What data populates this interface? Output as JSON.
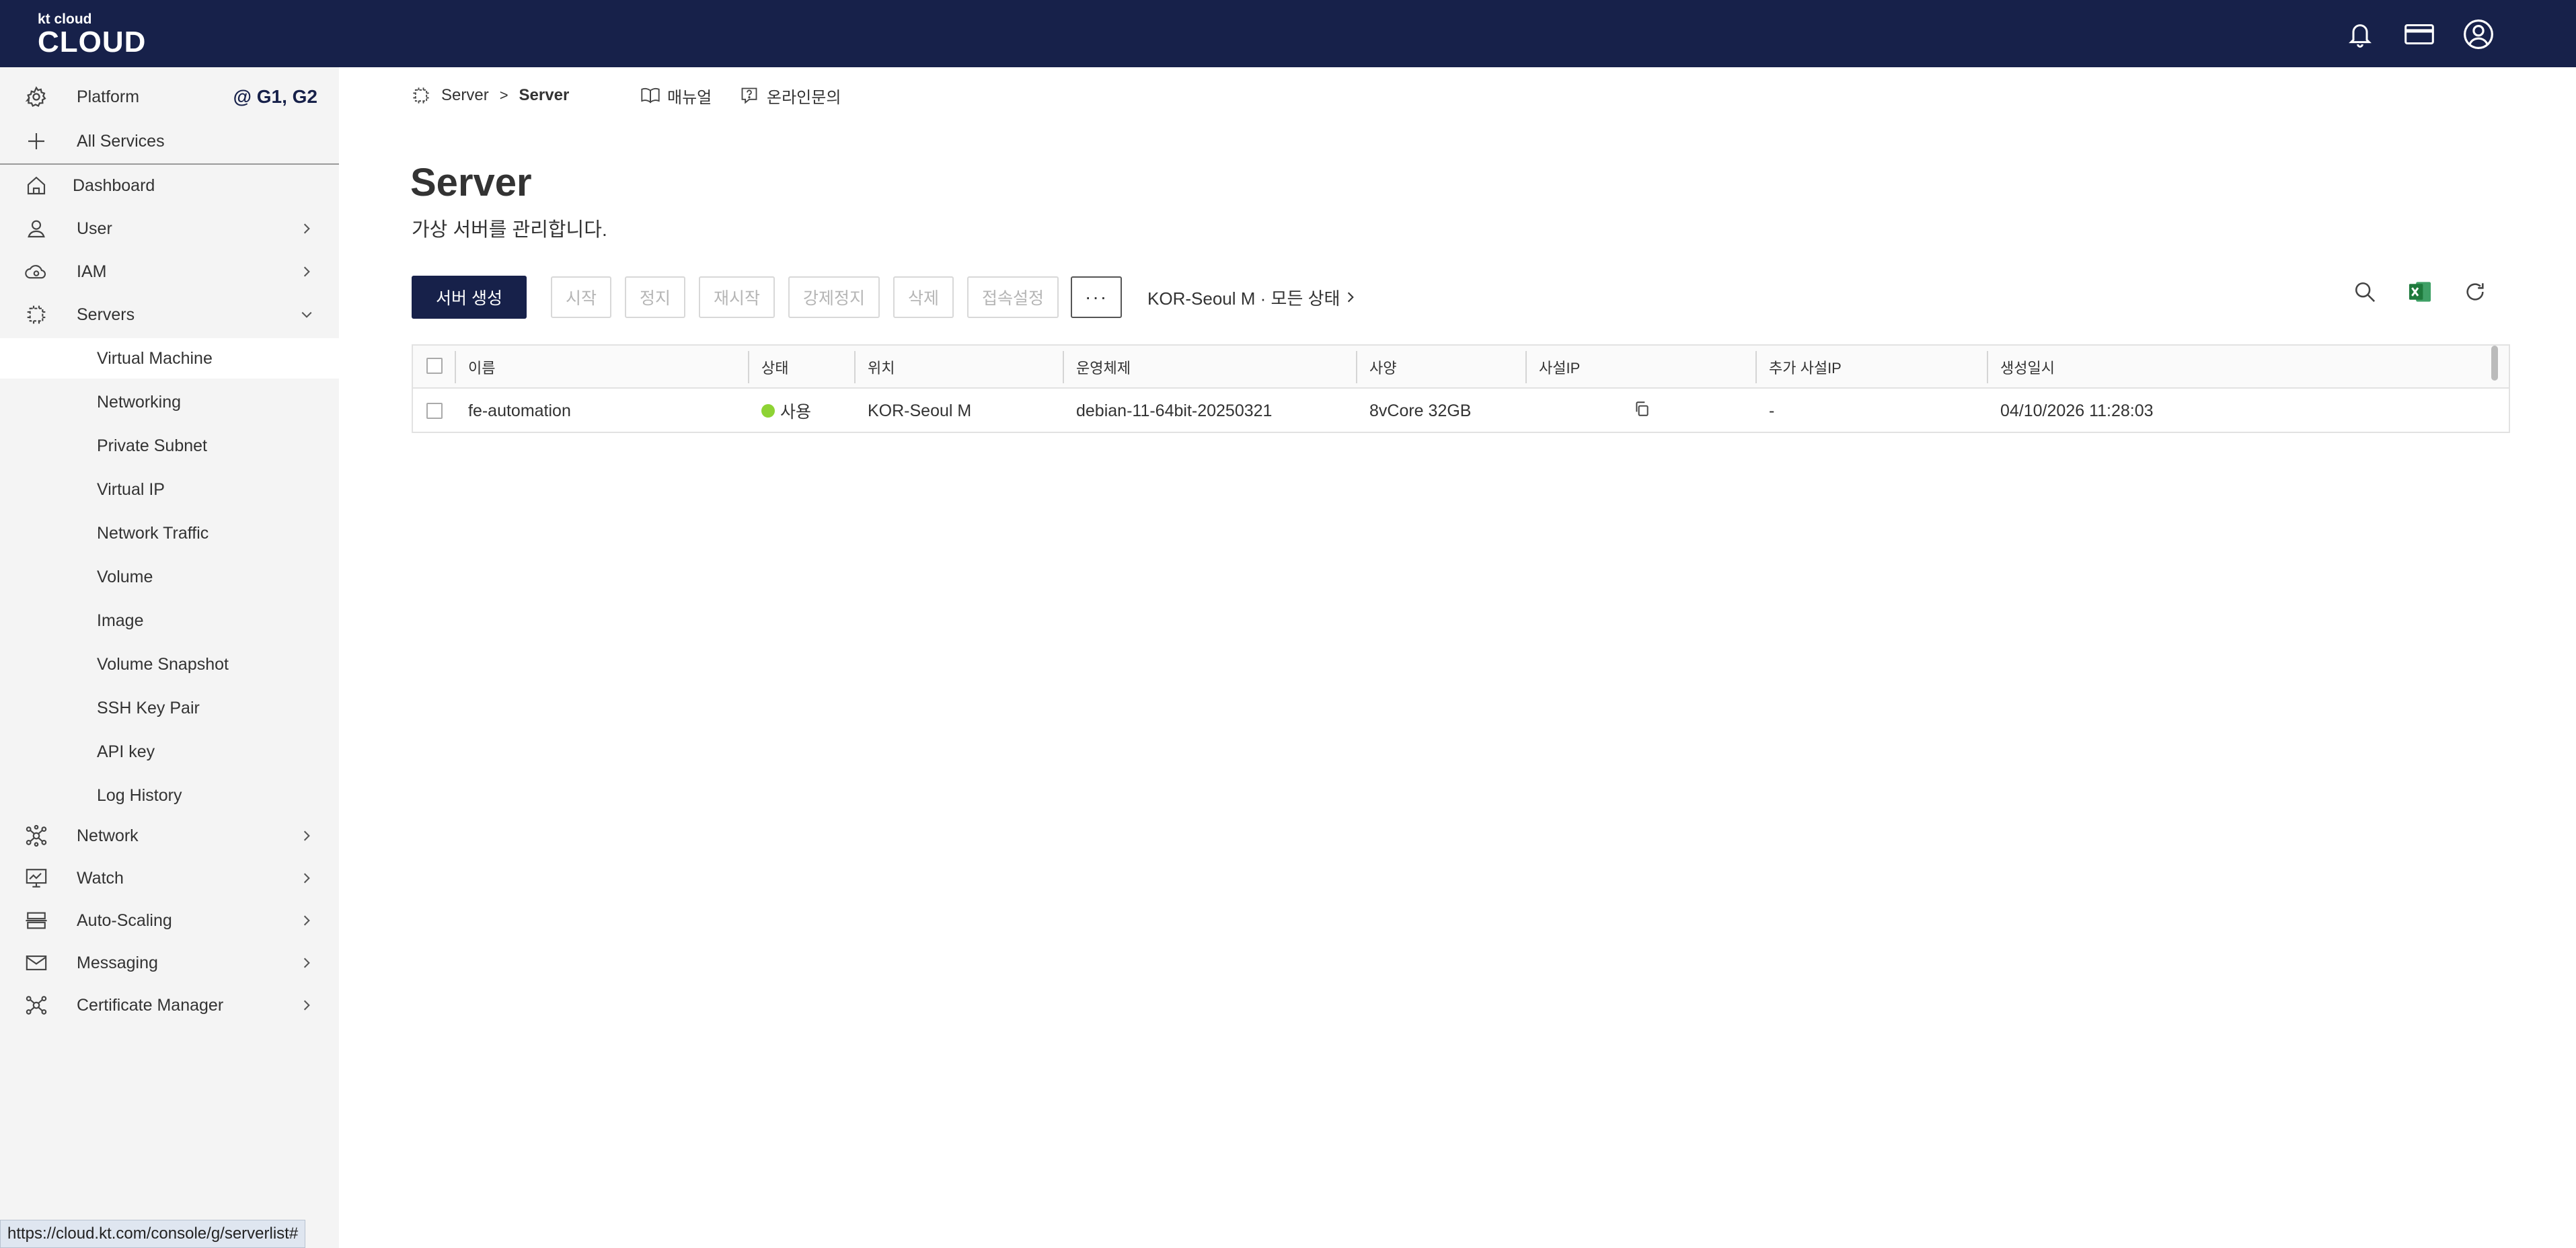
{
  "header": {
    "logo_small": "kt cloud",
    "logo_big": "CLOUD",
    "icons": [
      "bell-icon",
      "card-icon",
      "user-circle-icon"
    ]
  },
  "sidebar": {
    "platform_label": "Platform",
    "platform_tag": "@ G1, G2",
    "all_services": "All Services",
    "items": [
      {
        "label": "Dashboard",
        "icon": "home-icon",
        "has_chevron": false
      },
      {
        "label": "User",
        "icon": "person-icon",
        "has_chevron": true
      },
      {
        "label": "IAM",
        "icon": "cloud-icon",
        "has_chevron": true
      },
      {
        "label": "Servers",
        "icon": "chip-icon",
        "has_chevron": true,
        "expanded": true
      }
    ],
    "server_subitems": [
      {
        "label": "Virtual Machine",
        "active": true
      },
      {
        "label": "Networking"
      },
      {
        "label": "Private Subnet"
      },
      {
        "label": "Virtual IP"
      },
      {
        "label": "Network Traffic"
      },
      {
        "label": "Volume"
      },
      {
        "label": "Image"
      },
      {
        "label": "Volume Snapshot"
      },
      {
        "label": "SSH Key Pair"
      },
      {
        "label": "API key"
      },
      {
        "label": "Log History"
      }
    ],
    "bottom_items": [
      {
        "label": "Network",
        "icon": "network-icon"
      },
      {
        "label": "Watch",
        "icon": "monitor-icon"
      },
      {
        "label": "Auto-Scaling",
        "icon": "scaling-icon"
      },
      {
        "label": "Messaging",
        "icon": "mail-icon"
      },
      {
        "label": "Certificate Manager",
        "icon": "certificate-icon"
      }
    ]
  },
  "breadcrumb": {
    "root": "Server",
    "separator": ">",
    "current": "Server",
    "manual": "매뉴얼",
    "inquiry": "온라인문의"
  },
  "page": {
    "title": "Server",
    "description": "가상 서버를 관리합니다."
  },
  "toolbar": {
    "create": "서버 생성",
    "start": "시작",
    "stop": "정지",
    "restart": "재시작",
    "force_stop": "강제정지",
    "delete": "삭제",
    "access": "접속설정",
    "more": "···",
    "filter": "KOR-Seoul M · 모든 상태"
  },
  "table": {
    "columns": [
      "이름",
      "상태",
      "위치",
      "운영체제",
      "사양",
      "사설IP",
      "추가 사설IP",
      "생성일시"
    ],
    "rows": [
      {
        "name": "fe-automation",
        "status": "사용",
        "status_color": "#8ed334",
        "location": "KOR-Seoul M",
        "os": "debian-11-64bit-20250321",
        "spec": "8vCore 32GB",
        "extra_ip": "-",
        "created": "04/10/2026 11:28:03"
      }
    ]
  },
  "statusbar": {
    "url": "https://cloud.kt.com/console/g/serverlist#"
  },
  "colors": {
    "brand_navy": "#17214a",
    "sidebar_bg": "#f4f4f4",
    "excel_green": "#1f7a3d"
  }
}
